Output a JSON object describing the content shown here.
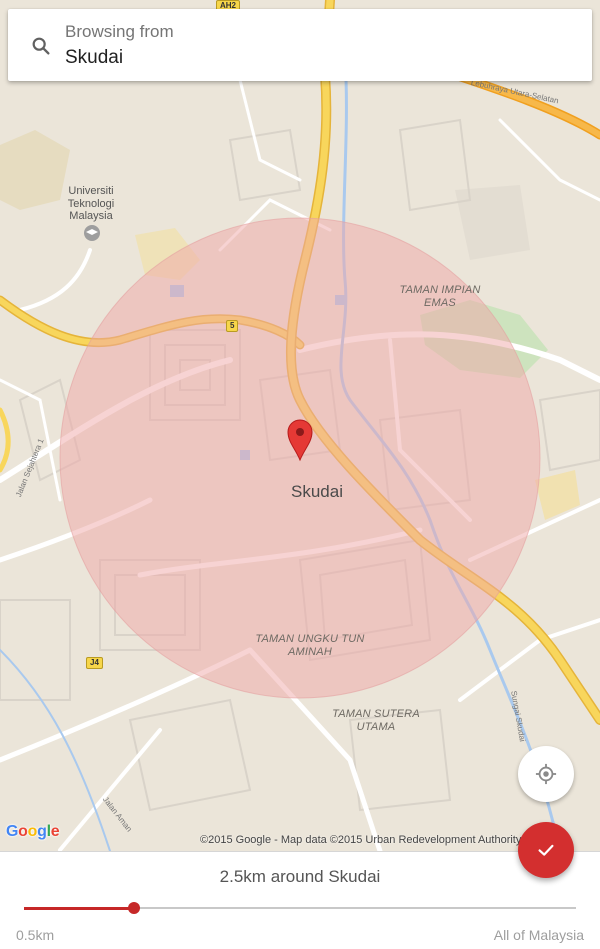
{
  "search": {
    "label": "Browsing from",
    "value": "Skudai",
    "icon": "search-icon"
  },
  "map": {
    "center_label": "Skudai",
    "places": {
      "university": "Universiti Teknologi Malaysia",
      "taman_impian_emas": "TAMAN IMPIAN EMAS",
      "taman_ungku": "TAMAN UNGKU TUN AMINAH",
      "taman_sutera": "TAMAN SUTERA UTAMA"
    },
    "road_shields": {
      "route_5": "5",
      "route_j4": "J4",
      "route_ah2": "AH2"
    },
    "road_names": {
      "jalan_sejahtera": "Jalan Sejahtera 1",
      "jalan_aman": "Jalan Aman",
      "sungai_skudai": "Sungai Skudai",
      "lebuhraya": "Lebuhraya Utara-Selatan"
    },
    "logo": "Google",
    "attribution": "©2015 Google - Map data ©2015 Urban Redevelopment Authority, Google",
    "colors": {
      "radius_fill": "#f0b8b8",
      "marker": "#e53935",
      "highway": "#f6c23e",
      "river": "#a8c8f0"
    }
  },
  "controls": {
    "my_location_icon": "my-location-icon",
    "confirm_icon": "check-icon",
    "confirm_color": "#d32f2f"
  },
  "radius": {
    "summary": "2.5km around Skudai",
    "min_label": "0.5km",
    "max_label": "All of Malaysia",
    "slider_fraction": 0.2,
    "accent_color": "#c62828"
  }
}
